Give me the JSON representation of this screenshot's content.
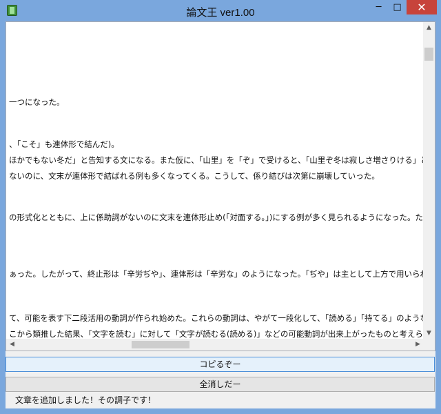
{
  "window": {
    "title": "論文王 ver1.00",
    "icon": "book-icon",
    "controls": {
      "minimize": "─",
      "maximize": "□",
      "close": "✕"
    }
  },
  "textarea": {
    "lines": [
      "一つになった。",
      "、「こそ」も連体形で結んだ)。",
      "ほかでもない冬だ」と告知する文になる。また仮に、「山里」を「ぞ」で受けると、「山里ぞ冬は寂しさ増さりける」という形になり、「冬に",
      "ないのに、文末が連体形で結ばれる例も多くなってくる。こうして、係り結びは次第に崩壊していった。",
      "の形式化とともに、上に係助詞がないのに文末を連体形止め(「対面する。」)にする例が多く見られるようになった。たとえば、『源氏",
      "ぁった。したがって、終止形は「辛労ぢや」、連体形は「辛労な」のようになった。「ぢや」は主として上方で用いられ、東国では「だ」が用",
      "て、可能を表す下二段活用の動詞が作られ始めた。これらの動詞は、やがて一段化して、「読める」「持てる」のような語形で用いら",
      "こから類推した結果、「文字を読む」に対して「文字が読むる(読める)」などの可能動詞が出来上がったものと考えられる。"
    ]
  },
  "buttons": {
    "copy": "コピるぞー",
    "clear": "全消しだー"
  },
  "status": "文章を追加しました！その調子です！",
  "colors": {
    "titlebar": "#7aa7dd",
    "close": "#c7433b",
    "focus_border": "#4a8ed8"
  }
}
